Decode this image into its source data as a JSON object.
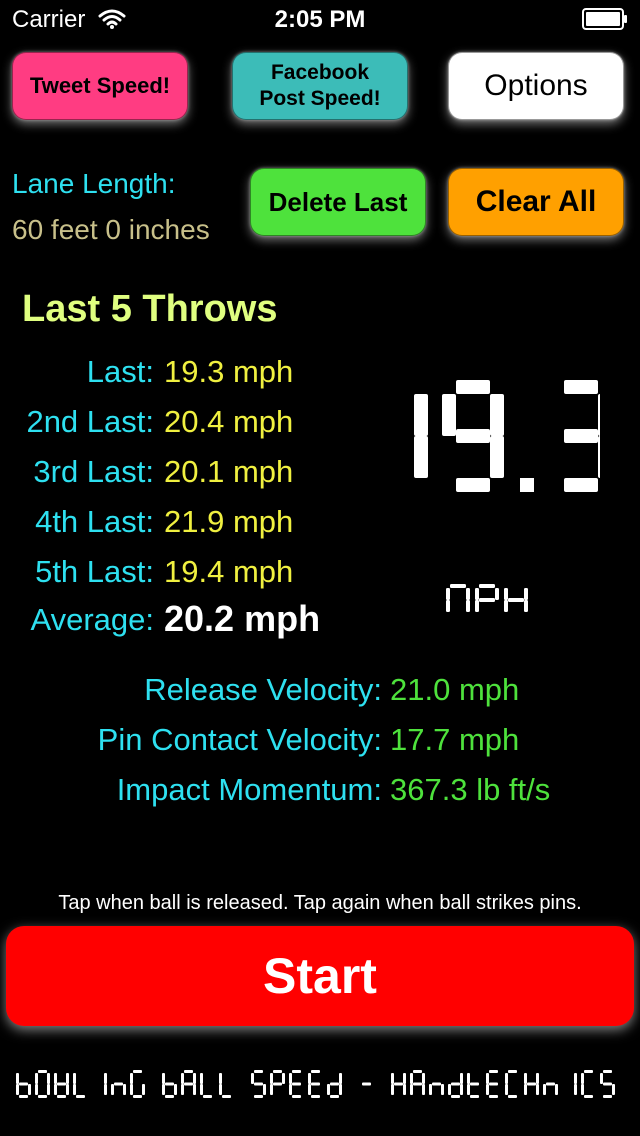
{
  "status_bar": {
    "carrier": "Carrier",
    "time": "2:05 PM"
  },
  "buttons": {
    "tweet": "Tweet Speed!",
    "facebook_line1": "Facebook",
    "facebook_line2": "Post Speed!",
    "options": "Options",
    "delete_last": "Delete Last",
    "clear_all": "Clear All",
    "start": "Start"
  },
  "lane": {
    "label": "Lane Length:",
    "value": "60 feet 0 inches"
  },
  "throws": {
    "title": "Last 5 Throws",
    "items": [
      {
        "label": "Last:",
        "value": "19.3 mph"
      },
      {
        "label": "2nd Last:",
        "value": "20.4 mph"
      },
      {
        "label": "3rd Last:",
        "value": "20.1 mph"
      },
      {
        "label": "4th Last:",
        "value": "21.9 mph"
      },
      {
        "label": "5th Last:",
        "value": "19.4 mph"
      }
    ],
    "average_label": "Average:",
    "average_value": "20.2 mph"
  },
  "speed_display": {
    "value": "19.3",
    "unit": "MPH"
  },
  "stats": [
    {
      "label": "Release Velocity:",
      "value": "21.0 mph"
    },
    {
      "label": "Pin Contact Velocity:",
      "value": "17.7 mph"
    },
    {
      "label": "Impact Momentum:",
      "value": "367.3 lb ft/s"
    }
  ],
  "hint": "Tap when ball is released. Tap again when ball strikes pins.",
  "footer": "BOWLING BALL SPEED - HANDTECHNICS",
  "colors": {
    "tweet": "#ff3c82",
    "facebook": "#3cbcb8",
    "options": "#ffffff",
    "delete": "#4ee23c",
    "clear": "#ffa000",
    "start": "#ff0000",
    "label_cyan": "#2ee0f0",
    "value_yellow": "#f0f040",
    "value_green": "#4ee23c"
  },
  "icons": [
    "wifi-icon",
    "battery-icon"
  ]
}
